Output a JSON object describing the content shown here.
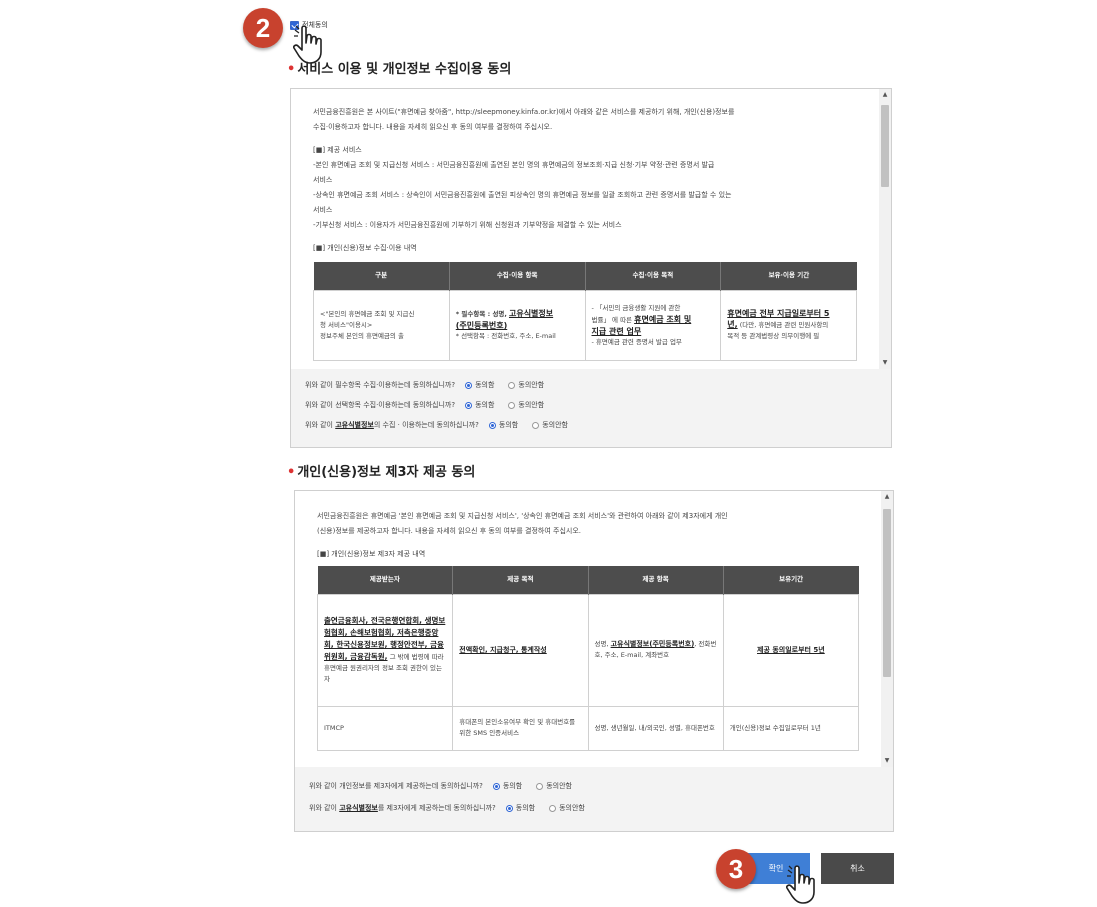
{
  "steps": {
    "step_agree": "2",
    "step_confirm": "3"
  },
  "agree_all": {
    "label": "전체동의",
    "checked": true
  },
  "section1": {
    "title": "서비스 이용 및 개인정보 수집이용 동의",
    "intro_line1": "서민금융진흥원은 본 사이트(\"휴면예금 찾아줌\", http://sleepmoney.kinfa.or.kr)에서 아래와 같은 서비스를 제공하기 위해, 개인(신용)정보를",
    "intro_line2": "수집·이용하고자 합니다. 내용을 자세히 읽으신 후 동의 여부를 결정하여 주십시오.",
    "service_heading": "[■] 제공 서비스",
    "service_1": "-본인 휴면예금 조회 및 지급신청 서비스 : 서민금융진흥원에 출연된 본인 명의 휴면예금의 정보조회·지급 신청·기부 약정·관련 증명서 발급",
    "service_1b": "서비스",
    "service_2": "-상속인 휴면예금 조회 서비스 : 상속인이 서민금융진흥원에 출연된 피상속인 명의 휴면예금 정보를 일괄 조회하고 관련 증명서를 발급할 수 있는",
    "service_2b": "서비스",
    "service_3": "-기부신청 서비스 : 이용자가 서민금융진흥원에 기부하기 위해 신청원과 기부약정을 체결할 수 있는 서비스",
    "table_heading": "[■] 개인(신용)정보 수집·이용 내역",
    "table_headers": [
      "구분",
      "수집·이용 항목",
      "수집·이용 목적",
      "보유·이용 기간"
    ],
    "row1_col1_a": "<\"본인의 휴면예금 조회 및 지급신",
    "row1_col1_b": "청 서비스\"이용시>",
    "row1_col1_c": "정보주체 본인의 휴면예금의 출",
    "row1_col2_a": "* 필수항목 : 성명,",
    "row1_col2_b": "고유식별정보",
    "row1_col2_c": "(주민등록번호)",
    "row1_col2_d": "* 선택항목 : 전화번호, 주소, E-mail",
    "row1_col3_a": "- 「서민의 금융생활 지원에 관한",
    "row1_col3_b": "법률」 에 따른",
    "row1_col3_c": "휴면예금 조회 및",
    "row1_col3_d": "지급 관련 업무",
    "row1_col3_e": "- 휴면예금 관련 증명서 발급 업무",
    "row1_col4_a": "휴면예금 전부 지급일로부터 5",
    "row1_col4_b": "년,",
    "row1_col4_c": "(다만, 휴면예금 관련 민원사항의",
    "row1_col4_d": "목적 등 관계법령상 의무이행에 필",
    "consent_q1": "위와 같이 필수항목 수집·이용하는데 동의하십니까?",
    "consent_q2": "위와 같이 선택항목 수집·이용하는데 동의하십니까?",
    "consent_q3_pre": "위와 같이",
    "consent_q3_bold": "고유식별정보",
    "consent_q3_post": "의 수집 · 이용하는데 동의하십니까?",
    "agree": "동의함",
    "disagree": "동의안함"
  },
  "section2": {
    "title": "개인(신용)정보 제3자 제공 동의",
    "intro_line1": "서민금융진흥원은 휴면예금 '본인 휴면예금 조회 및 지급신청 서비스', '상속인 휴면예금 조회 서비스'와 관련하여 아래와 같이 제3자에게 개인",
    "intro_line2": "(신용)정보를 제공하고자 합니다. 내용을 자세히 읽으신 후 동의 여부를 결정하여 주십시오.",
    "table_heading": "[■] 개인(신용)정보 제3자 제공 내역",
    "table_headers": [
      "제공받는자",
      "제공 목적",
      "제공 항목",
      "보유기간"
    ],
    "row1_col1_bold": "출연금융회사, 전국은행연합회, 생명보험협회, 손해보험협회, 저축은행중앙회, 한국신용정보원, 행정안전부, 금융위원회, 금융감독원,",
    "row1_col1_rest": "그 밖에 법령에 따라 휴면예금 원권리자의 정보 조회 권한이 있는 자",
    "row1_col2": "전액확인, 지급청구, 통계작성",
    "row1_col3_a": "성명,",
    "row1_col3_b": "고유식별정보(주민등록번호)",
    "row1_col3_c": ", 전화번호, 주소, E-mail, 계좌번호",
    "row1_col4": "제공 동의일로부터 5년",
    "row2_col1": "ITMCP",
    "row2_col2": "휴대폰의 본인소유여부 확인 및 휴대번호를 위한 SMS 인증서비스",
    "row2_col3": "성명, 생년월일, 내/외국인, 성별, 휴대폰번호",
    "row2_col4": "개인(신용)정보 수집일로부터 1년",
    "consent_q1": "위와 같이 개인정보를 제3자에게 제공하는데 동의하십니까?",
    "consent_q2_pre": "위와 같이",
    "consent_q2_bold": "고유식별정보",
    "consent_q2_post": "를 제3자에게 제공하는데 동의하십니까?",
    "agree": "동의함",
    "disagree": "동의안함"
  },
  "buttons": {
    "confirm": "확인",
    "cancel": "취소"
  },
  "colors": {
    "badge": "#c8422e",
    "confirm": "#3f7fd6",
    "cancel": "#4a4a4a",
    "table_header": "#4d4d4d"
  },
  "icons": [
    "hand-pointer-icon",
    "checkbox-icon",
    "scroll-up-icon",
    "scroll-down-icon"
  ]
}
